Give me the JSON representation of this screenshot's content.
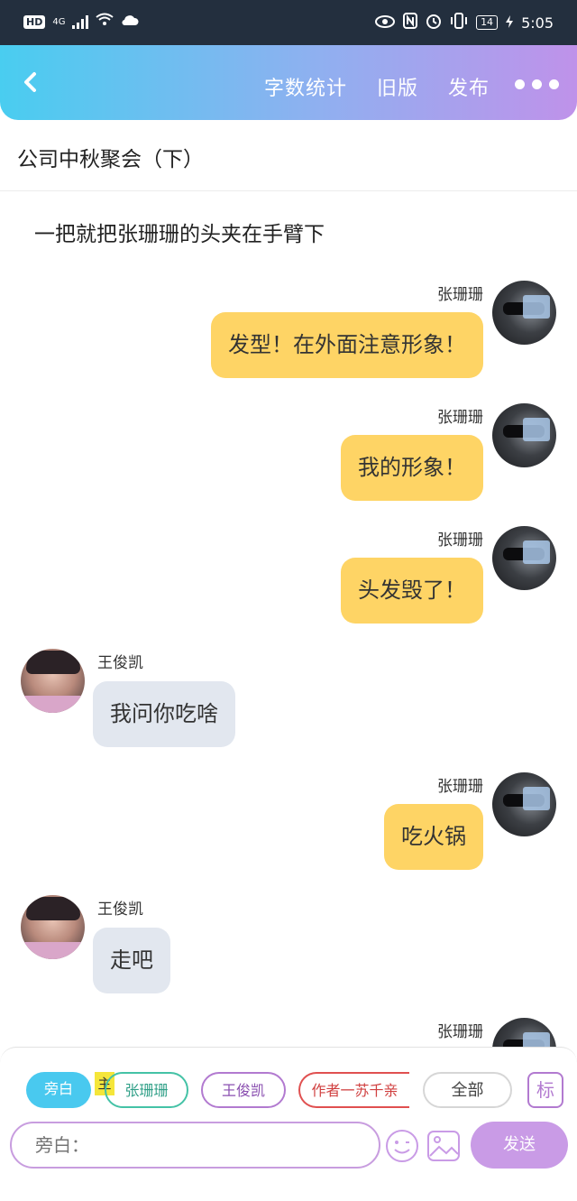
{
  "status_bar": {
    "network": "4G",
    "hd": "HD",
    "battery": "14",
    "time": "5:05"
  },
  "header": {
    "word_count": "字数统计",
    "old_version": "旧版",
    "publish": "发布"
  },
  "page_title": "公司中秋聚会（下）",
  "narration": "一把就把张珊珊的头夹在手臂下",
  "messages": [
    {
      "side": "right",
      "name": "张珊珊",
      "text": "发型！在外面注意形象！"
    },
    {
      "side": "right",
      "name": "张珊珊",
      "text": "我的形象！"
    },
    {
      "side": "right",
      "name": "张珊珊",
      "text": "头发毁了！"
    },
    {
      "side": "left",
      "name": "王俊凯",
      "text": "我问你吃啥"
    },
    {
      "side": "right",
      "name": "张珊珊",
      "text": "吃火锅"
    },
    {
      "side": "left",
      "name": "王俊凯",
      "text": "走吧"
    },
    {
      "side": "right",
      "name": "张珊珊",
      "text": ""
    }
  ],
  "composer": {
    "chips": {
      "narration": "旁白",
      "main_tag": "主",
      "zhang": "张珊珊",
      "wang": "王俊凯",
      "author": "作者一苏千亲",
      "all": "全部"
    },
    "tag_button": "标",
    "input_placeholder": "旁白：",
    "send": "发送"
  },
  "colors": {
    "header_start": "#49cdf0",
    "header_end": "#bf92ea",
    "bubble_right": "#fed465",
    "bubble_left": "#e2e7ef",
    "send": "#c99be6"
  }
}
